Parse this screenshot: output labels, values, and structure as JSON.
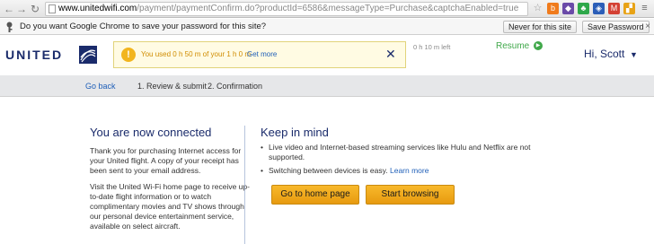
{
  "browser": {
    "url_host": "www.unitedwifi.com",
    "url_path": "/payment/paymentConfirm.do?productId=6586&messageType=Purchase&captchaEnabled=true",
    "extensions": [
      {
        "name": "star-icon",
        "color": "#ffffff"
      },
      {
        "name": "orange-extension",
        "color": "#f07b1c"
      },
      {
        "name": "purple-extension",
        "color": "#6a4aa8"
      },
      {
        "name": "green-extension",
        "color": "#2ea84a"
      },
      {
        "name": "blue-extension",
        "color": "#2b5eb8"
      },
      {
        "name": "gmail-icon",
        "color": "#d44134"
      },
      {
        "name": "mixed-extension",
        "color": "#e8a317"
      }
    ]
  },
  "infobar": {
    "message": "Do you want Google Chrome to save your password for this site?",
    "never_label": "Never for this site",
    "save_label": "Save Password",
    "close_label": "×"
  },
  "header": {
    "logo": "UNITED",
    "usage_text": "You used 0 h 50 m of your 1 h 0 m",
    "get_more": "Get more",
    "banner_close": "✕",
    "time_left": "0 h 10 m left",
    "resume": "Resume",
    "greeting": "Hi, Scott",
    "caret": "▼"
  },
  "steps": {
    "go_back": "Go back",
    "step1": "1. Review & submit",
    "step2": "2. Confirmation"
  },
  "main": {
    "heading": "You are now connected",
    "para1": "Thank you for purchasing Internet access for your United flight. A copy of your receipt has been sent to your email address.",
    "para2": "Visit the United Wi-Fi home page to receive up-to-date flight information or to watch complimentary movies and TV shows through our personal device entertainment service, available on select aircraft.",
    "keep_heading": "Keep in mind",
    "bullet1": "Live video and Internet-based streaming services like Hulu and Netflix are not supported.",
    "bullet2_text": "Switching between devices is easy.",
    "bullet2_link": "Learn more",
    "home_button": "Go to home page",
    "browse_button": "Start browsing"
  },
  "colors": {
    "brand_navy": "#1a2b6b",
    "link_blue": "#1f5fb8",
    "button_gold": "#f2a91e",
    "resume_green": "#40a84a"
  }
}
